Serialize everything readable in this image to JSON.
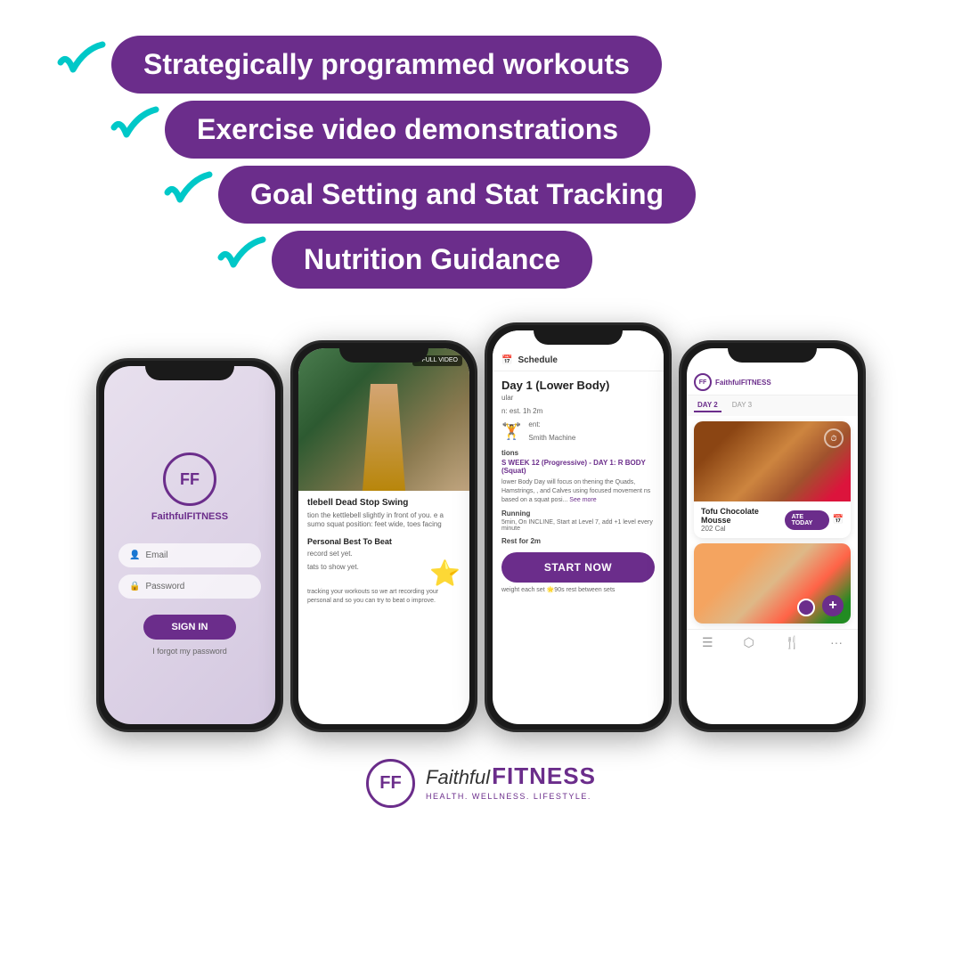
{
  "features": {
    "items": [
      {
        "id": "feature-1",
        "label": "Strategically programmed workouts"
      },
      {
        "id": "feature-2",
        "label": "Exercise video demonstrations"
      },
      {
        "id": "feature-3",
        "label": "Goal Setting and Stat Tracking"
      },
      {
        "id": "feature-4",
        "label": "Nutrition Guidance"
      }
    ]
  },
  "phones": {
    "phone1": {
      "logo_text": "FF",
      "brand": "FaithfulFITNESS",
      "email_label": "Email",
      "password_label": "Password",
      "signin_label": "SIGN IN",
      "forgot_label": "I forgot my password"
    },
    "phone2": {
      "full_video_label": "⏵ FULL VIDEO",
      "exercise_title": "tlebell Dead Stop Swing",
      "exercise_desc": "tion the kettlebell slightly in front of you. e a sumo squat position: feet wide, toes facing",
      "expand_icon": "∨",
      "personal_best": "Personal Best To Beat",
      "record_label": "record set yet.",
      "no_stats": "tats to show yet.",
      "stats_text": "tracking your workouts so we art recording your personal and so you can try to beat o improve."
    },
    "phone3": {
      "schedule_label": "Schedule",
      "day_title": "Day 1 (Lower Body)",
      "type_label": "ular",
      "duration_label": "n: est. 1h 2m",
      "equipment_label": "ent:",
      "equipment_name": "Smith\nMachine",
      "instructions_label": "tions",
      "instructions_title": "S WEEK 12 (Progressive) - DAY 1:\nR BODY (Squat)",
      "instructions_text": "lower Body Day will focus on\nthening the Quads, Hamstrings,\n, and Calves using focused movement\nns based on a squat posi...",
      "see_more_label": "See more",
      "cardio_label": "Running",
      "cardio_desc": "5min, On INCLINE, Start at Level 7, add +1\nlevel every minute",
      "rest_label": "Rest for 2m",
      "start_btn_label": "START NOW",
      "sets_info": "weight each set\n🌟90s rest between sets"
    },
    "phone4": {
      "logo_text": "FF",
      "brand_text": "FaithfulFITNESS",
      "day1_label": "DAY 2",
      "day2_label": "DAY 3",
      "food1_name": "Tofu Chocolate Mousse",
      "food1_cal": "202 Cal",
      "food1_ate_label": "ATE TODAY",
      "nav_icons": [
        "☰",
        "⬡",
        "🍴",
        "···"
      ]
    }
  },
  "footer": {
    "logo_text": "FF",
    "faithful_text": "Faithful",
    "fitness_text": "FITNESS",
    "tagline": "HEALTH. WELLNESS. LIFESTYLE."
  },
  "colors": {
    "purple": "#6b2d8b",
    "teal": "#00c8c8",
    "white": "#ffffff"
  }
}
